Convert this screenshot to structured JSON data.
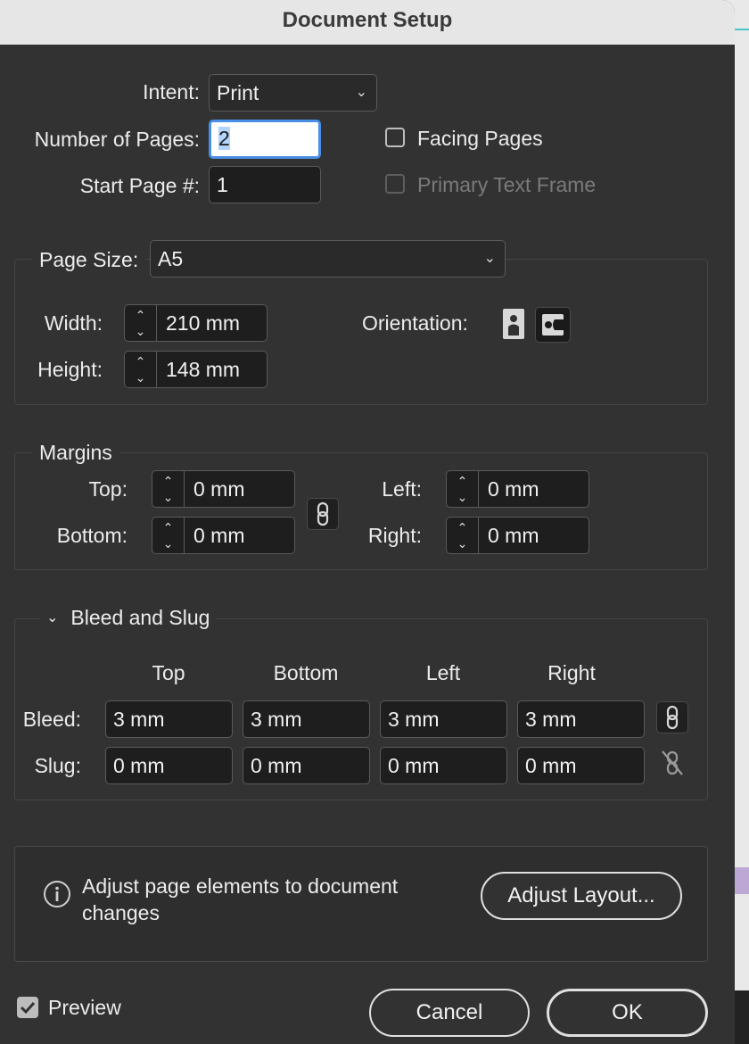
{
  "window": {
    "title": "Document Setup"
  },
  "intent": {
    "label": "Intent:",
    "value": "Print"
  },
  "pages": {
    "number_label": "Number of Pages:",
    "number_value": "2",
    "start_label": "Start Page #:",
    "start_value": "1",
    "facing_label": "Facing Pages",
    "facing_checked": false,
    "primary_label": "Primary Text Frame",
    "primary_checked": false
  },
  "page_size": {
    "label": "Page Size:",
    "value": "A5",
    "width_label": "Width:",
    "width_value": "210 mm",
    "height_label": "Height:",
    "height_value": "148 mm",
    "orientation_label": "Orientation:",
    "orientation_selected": "landscape"
  },
  "margins": {
    "title": "Margins",
    "top_label": "Top:",
    "top_value": "0 mm",
    "bottom_label": "Bottom:",
    "bottom_value": "0 mm",
    "left_label": "Left:",
    "left_value": "0 mm",
    "right_label": "Right:",
    "right_value": "0 mm"
  },
  "bleed_slug": {
    "title": "Bleed and Slug",
    "columns": [
      "Top",
      "Bottom",
      "Left",
      "Right"
    ],
    "bleed_label": "Bleed:",
    "bleed_values": [
      "3 mm",
      "3 mm",
      "3 mm",
      "3 mm"
    ],
    "slug_label": "Slug:",
    "slug_values": [
      "0 mm",
      "0 mm",
      "0 mm",
      "0 mm"
    ]
  },
  "adjust": {
    "message_line1": "Adjust page elements to document",
    "message_line2": "changes",
    "button_label": "Adjust Layout..."
  },
  "footer": {
    "preview_label": "Preview",
    "preview_checked": true,
    "cancel_label": "Cancel",
    "ok_label": "OK"
  },
  "colors": {
    "accent": "#4a8fe6",
    "dialog_bg": "#323232",
    "field_bg": "#1e1e1e"
  }
}
